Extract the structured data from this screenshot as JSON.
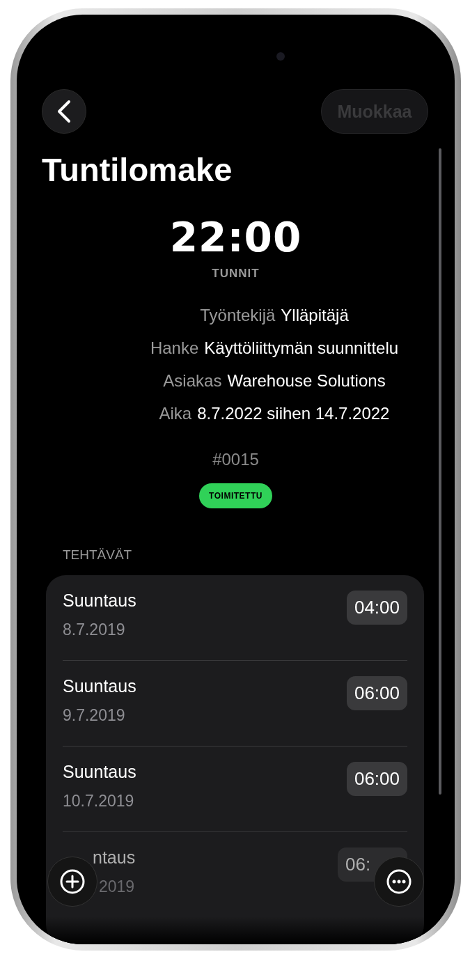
{
  "nav": {
    "edit": {
      "label": "Muokkaa",
      "disabled": true
    }
  },
  "title": "Tuntilomake",
  "total": {
    "value": "22:00",
    "label": "TUNNIT"
  },
  "details": [
    {
      "label": "Työntekijä",
      "value": "Ylläpitäjä"
    },
    {
      "label": "Hanke",
      "value": "Käyttöliittymän suunnittelu"
    },
    {
      "label": "Asiakas",
      "value": "Warehouse Solutions"
    },
    {
      "label": "Aika",
      "value": "8.7.2022 siihen 14.7.2022"
    }
  ],
  "number": "#0015",
  "status": {
    "label": "TOIMITETTU",
    "color": "#30d158"
  },
  "tasks_header": "TEHTÄVÄT",
  "tasks": [
    {
      "title": "Suuntaus",
      "date": "8.7.2019",
      "duration": "04:00"
    },
    {
      "title": "Suuntaus",
      "date": "9.7.2019",
      "duration": "06:00"
    },
    {
      "title": "Suuntaus",
      "date": "10.7.2019",
      "duration": "06:00"
    },
    {
      "title": "ntaus",
      "date": "2019",
      "duration": "06:",
      "kind": "covered"
    }
  ]
}
